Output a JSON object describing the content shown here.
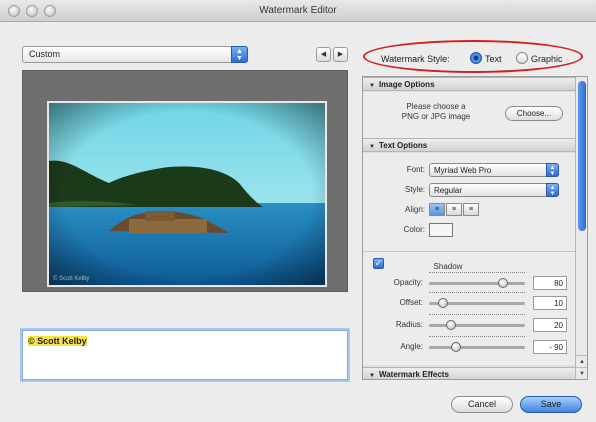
{
  "window": {
    "title": "Watermark Editor"
  },
  "preset": {
    "value": "Custom"
  },
  "watermark_style": {
    "label": "Watermark Style:",
    "options": [
      {
        "label": "Text",
        "selected": true
      },
      {
        "label": "Graphic",
        "selected": false
      }
    ]
  },
  "preview": {
    "photo_credit": "© Scott Kelby"
  },
  "text_field": {
    "value": "© Scott Kelby"
  },
  "image_options": {
    "header": "Image Options",
    "prompt_line1": "Please choose a",
    "prompt_line2": "PNG or JPG image",
    "choose_label": "Choose..."
  },
  "text_options": {
    "header": "Text Options",
    "font_label": "Font:",
    "font_value": "Myriad Web Pro",
    "style_label": "Style:",
    "style_value": "Regular",
    "align_label": "Align:",
    "color_label": "Color:"
  },
  "shadow": {
    "label": "Shadow",
    "enabled": true,
    "opacity": {
      "label": "Opacity:",
      "value": "80",
      "level": 0.8
    },
    "offset": {
      "label": "Offset:",
      "value": "10",
      "level": 0.1
    },
    "radius": {
      "label": "Radius:",
      "value": "20",
      "level": 0.2
    },
    "angle": {
      "label": "Angle:",
      "value": "- 90",
      "level": 0.25
    }
  },
  "watermark_effects": {
    "header": "Watermark Effects"
  },
  "buttons": {
    "cancel": "Cancel",
    "save": "Save"
  },
  "colors": {
    "accent": "#2f6bd3",
    "highlight_ring": "#d41f1f",
    "text_highlight": "#f5e54a"
  }
}
